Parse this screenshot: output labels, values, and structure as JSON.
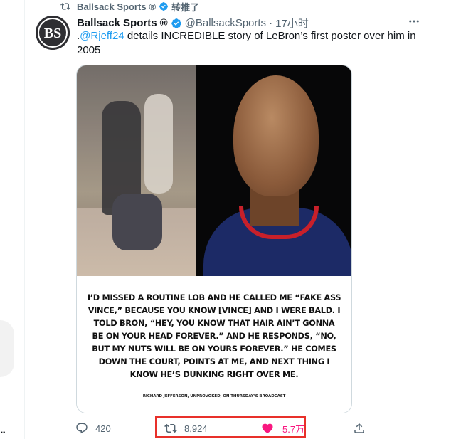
{
  "retweet_banner": {
    "icon": "retweet-icon",
    "account": "Ballsack Sports",
    "registered": "®",
    "action_text": "转推了"
  },
  "tweet": {
    "avatar_text": "BS",
    "author_name": "Ballsack Sports",
    "registered": "®",
    "handle": "@BallsackSports",
    "separator": "·",
    "time": "17小时",
    "text_prefix": ".",
    "mention": "@Rjeff24",
    "text_rest": " details INCREDIBLE story of LeBron’s first poster over him in 2005",
    "media": {
      "quote": "I’D MISSED A ROUTINE LOB AND HE CALLED ME “FAKE ASS VINCE,” BECAUSE YOU KNOW [VINCE] AND I WERE BALD. I TOLD BRON, “HEY, YOU KNOW THAT HAIR AIN’T GONNA BE ON YOUR HEAD FOREVER.” AND HE RESPONDS, “NO, BUT MY NUTS WILL BE ON YOURS FOREVER.” HE COMES DOWN THE COURT, POINTS AT ME, AND NEXT THING I KNOW HE’S DUNKING RIGHT OVER ME.",
      "attribution": "RICHARD JEFFERSON, UNPROVOKED, ON THURSDAY’S BROADCAST"
    },
    "actions": {
      "reply_count": "420",
      "retweet_count": "8,924",
      "like_count": "5.7万"
    }
  },
  "left_ellipsis": "..",
  "colors": {
    "accent": "#1d9bf0",
    "like": "#f91880",
    "muted": "#536471",
    "highlight": "#e8302a"
  }
}
